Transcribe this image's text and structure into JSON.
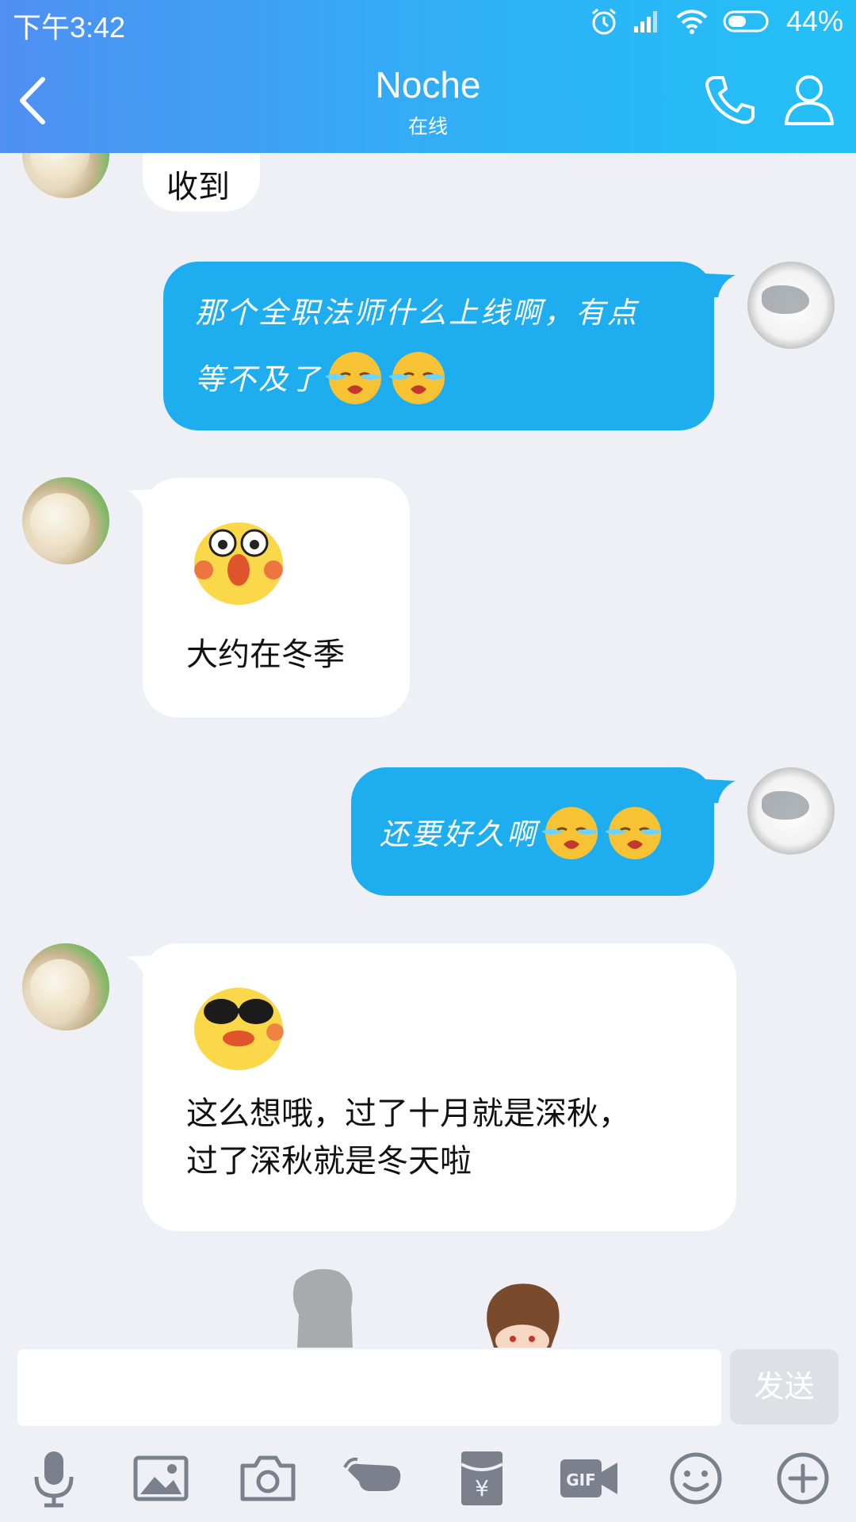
{
  "status": {
    "time": "下午3:42",
    "battery": "44%"
  },
  "header": {
    "title": "Noche",
    "subtitle": "在线"
  },
  "messages": {
    "m0": "收到",
    "m1_line1": "那个全职法师什么上线啊，有点",
    "m1_line2": "等不及了",
    "m2": "大约在冬季",
    "m3": "还要好久啊",
    "m4_line1": "这么想哦，过了十月就是深秋，",
    "m4_line2": "过了深秋就是冬天啦"
  },
  "input": {
    "send_label": "发送",
    "value": ""
  },
  "toolbar": [
    "mic-icon",
    "image-icon",
    "camera-icon",
    "poke-icon",
    "red-packet-icon",
    "gif-icon",
    "emoji-icon",
    "plus-icon"
  ],
  "colors": {
    "header_start": "#4f8ff2",
    "header_end": "#23c0f7",
    "bubble_self": "#1eaef0",
    "bubble_other": "#ffffff",
    "background": "#eef0f6"
  }
}
